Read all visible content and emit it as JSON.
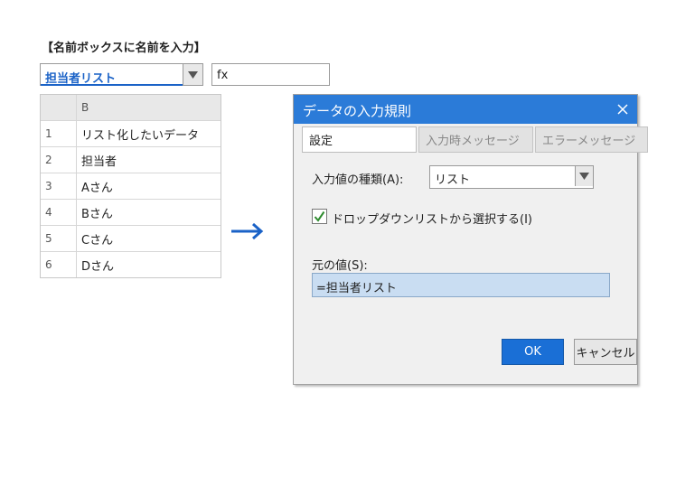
{
  "heading": "【名前ボックスに名前を入力】",
  "name_box": {
    "value": "担当者リスト"
  },
  "formula_bar": {
    "label": "fx"
  },
  "sheet": {
    "column_header": "B",
    "rows": [
      {
        "num": "1",
        "value": "リスト化したいデータ"
      },
      {
        "num": "2",
        "value": "担当者"
      },
      {
        "num": "3",
        "value": "Aさん"
      },
      {
        "num": "4",
        "value": "Bさん"
      },
      {
        "num": "5",
        "value": "Cさん"
      },
      {
        "num": "6",
        "value": "Dさん"
      }
    ]
  },
  "dialog": {
    "title": "データの入力規則",
    "tabs": [
      "設定",
      "入力時メッセージ",
      "エラーメッセージ"
    ],
    "allow_label": "入力値の種類(A):",
    "allow_value": "リスト",
    "dropdown_checkbox_label": "ドロップダウンリストから選択する(I)",
    "dropdown_checked": true,
    "source_label": "元の値(S):",
    "source_value": "=担当者リスト",
    "ok_label": "OK",
    "cancel_label": "キャンセル"
  },
  "colors": {
    "accent_blue": "#1a62c7",
    "titlebar": "#2b7bd8",
    "checkmark": "#2e8b2e",
    "source_field": "#c9ddf2"
  },
  "icons": [
    "dropdown-arrow-icon",
    "close-icon",
    "checkmark-icon",
    "right-arrow-icon"
  ]
}
